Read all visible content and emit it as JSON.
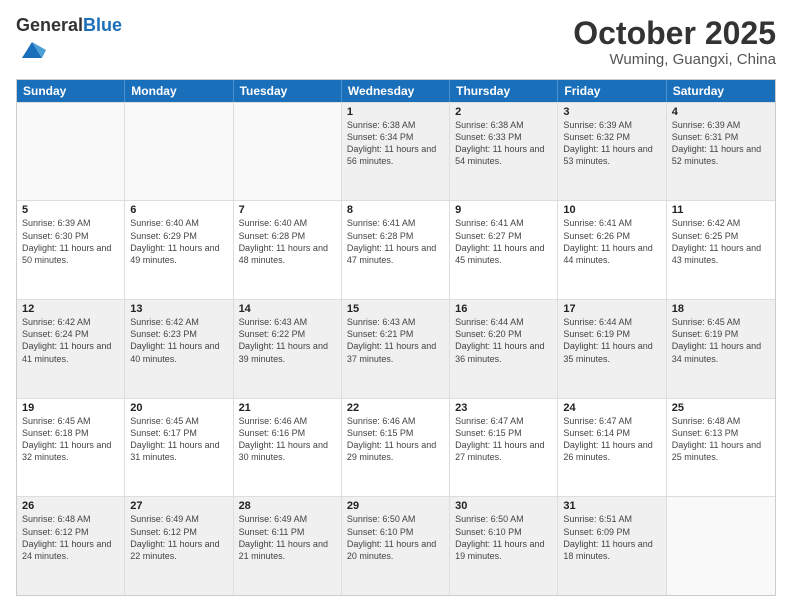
{
  "header": {
    "logo_general": "General",
    "logo_blue": "Blue",
    "month_title": "October 2025",
    "location": "Wuming, Guangxi, China"
  },
  "weekdays": [
    "Sunday",
    "Monday",
    "Tuesday",
    "Wednesday",
    "Thursday",
    "Friday",
    "Saturday"
  ],
  "weeks": [
    [
      {
        "day": "",
        "sunrise": "",
        "sunset": "",
        "daylight": "",
        "empty": true
      },
      {
        "day": "",
        "sunrise": "",
        "sunset": "",
        "daylight": "",
        "empty": true
      },
      {
        "day": "",
        "sunrise": "",
        "sunset": "",
        "daylight": "",
        "empty": true
      },
      {
        "day": "1",
        "sunrise": "Sunrise: 6:38 AM",
        "sunset": "Sunset: 6:34 PM",
        "daylight": "Daylight: 11 hours and 56 minutes.",
        "empty": false
      },
      {
        "day": "2",
        "sunrise": "Sunrise: 6:38 AM",
        "sunset": "Sunset: 6:33 PM",
        "daylight": "Daylight: 11 hours and 54 minutes.",
        "empty": false
      },
      {
        "day": "3",
        "sunrise": "Sunrise: 6:39 AM",
        "sunset": "Sunset: 6:32 PM",
        "daylight": "Daylight: 11 hours and 53 minutes.",
        "empty": false
      },
      {
        "day": "4",
        "sunrise": "Sunrise: 6:39 AM",
        "sunset": "Sunset: 6:31 PM",
        "daylight": "Daylight: 11 hours and 52 minutes.",
        "empty": false
      }
    ],
    [
      {
        "day": "5",
        "sunrise": "Sunrise: 6:39 AM",
        "sunset": "Sunset: 6:30 PM",
        "daylight": "Daylight: 11 hours and 50 minutes.",
        "empty": false
      },
      {
        "day": "6",
        "sunrise": "Sunrise: 6:40 AM",
        "sunset": "Sunset: 6:29 PM",
        "daylight": "Daylight: 11 hours and 49 minutes.",
        "empty": false
      },
      {
        "day": "7",
        "sunrise": "Sunrise: 6:40 AM",
        "sunset": "Sunset: 6:28 PM",
        "daylight": "Daylight: 11 hours and 48 minutes.",
        "empty": false
      },
      {
        "day": "8",
        "sunrise": "Sunrise: 6:41 AM",
        "sunset": "Sunset: 6:28 PM",
        "daylight": "Daylight: 11 hours and 47 minutes.",
        "empty": false
      },
      {
        "day": "9",
        "sunrise": "Sunrise: 6:41 AM",
        "sunset": "Sunset: 6:27 PM",
        "daylight": "Daylight: 11 hours and 45 minutes.",
        "empty": false
      },
      {
        "day": "10",
        "sunrise": "Sunrise: 6:41 AM",
        "sunset": "Sunset: 6:26 PM",
        "daylight": "Daylight: 11 hours and 44 minutes.",
        "empty": false
      },
      {
        "day": "11",
        "sunrise": "Sunrise: 6:42 AM",
        "sunset": "Sunset: 6:25 PM",
        "daylight": "Daylight: 11 hours and 43 minutes.",
        "empty": false
      }
    ],
    [
      {
        "day": "12",
        "sunrise": "Sunrise: 6:42 AM",
        "sunset": "Sunset: 6:24 PM",
        "daylight": "Daylight: 11 hours and 41 minutes.",
        "empty": false
      },
      {
        "day": "13",
        "sunrise": "Sunrise: 6:42 AM",
        "sunset": "Sunset: 6:23 PM",
        "daylight": "Daylight: 11 hours and 40 minutes.",
        "empty": false
      },
      {
        "day": "14",
        "sunrise": "Sunrise: 6:43 AM",
        "sunset": "Sunset: 6:22 PM",
        "daylight": "Daylight: 11 hours and 39 minutes.",
        "empty": false
      },
      {
        "day": "15",
        "sunrise": "Sunrise: 6:43 AM",
        "sunset": "Sunset: 6:21 PM",
        "daylight": "Daylight: 11 hours and 37 minutes.",
        "empty": false
      },
      {
        "day": "16",
        "sunrise": "Sunrise: 6:44 AM",
        "sunset": "Sunset: 6:20 PM",
        "daylight": "Daylight: 11 hours and 36 minutes.",
        "empty": false
      },
      {
        "day": "17",
        "sunrise": "Sunrise: 6:44 AM",
        "sunset": "Sunset: 6:19 PM",
        "daylight": "Daylight: 11 hours and 35 minutes.",
        "empty": false
      },
      {
        "day": "18",
        "sunrise": "Sunrise: 6:45 AM",
        "sunset": "Sunset: 6:19 PM",
        "daylight": "Daylight: 11 hours and 34 minutes.",
        "empty": false
      }
    ],
    [
      {
        "day": "19",
        "sunrise": "Sunrise: 6:45 AM",
        "sunset": "Sunset: 6:18 PM",
        "daylight": "Daylight: 11 hours and 32 minutes.",
        "empty": false
      },
      {
        "day": "20",
        "sunrise": "Sunrise: 6:45 AM",
        "sunset": "Sunset: 6:17 PM",
        "daylight": "Daylight: 11 hours and 31 minutes.",
        "empty": false
      },
      {
        "day": "21",
        "sunrise": "Sunrise: 6:46 AM",
        "sunset": "Sunset: 6:16 PM",
        "daylight": "Daylight: 11 hours and 30 minutes.",
        "empty": false
      },
      {
        "day": "22",
        "sunrise": "Sunrise: 6:46 AM",
        "sunset": "Sunset: 6:15 PM",
        "daylight": "Daylight: 11 hours and 29 minutes.",
        "empty": false
      },
      {
        "day": "23",
        "sunrise": "Sunrise: 6:47 AM",
        "sunset": "Sunset: 6:15 PM",
        "daylight": "Daylight: 11 hours and 27 minutes.",
        "empty": false
      },
      {
        "day": "24",
        "sunrise": "Sunrise: 6:47 AM",
        "sunset": "Sunset: 6:14 PM",
        "daylight": "Daylight: 11 hours and 26 minutes.",
        "empty": false
      },
      {
        "day": "25",
        "sunrise": "Sunrise: 6:48 AM",
        "sunset": "Sunset: 6:13 PM",
        "daylight": "Daylight: 11 hours and 25 minutes.",
        "empty": false
      }
    ],
    [
      {
        "day": "26",
        "sunrise": "Sunrise: 6:48 AM",
        "sunset": "Sunset: 6:12 PM",
        "daylight": "Daylight: 11 hours and 24 minutes.",
        "empty": false
      },
      {
        "day": "27",
        "sunrise": "Sunrise: 6:49 AM",
        "sunset": "Sunset: 6:12 PM",
        "daylight": "Daylight: 11 hours and 22 minutes.",
        "empty": false
      },
      {
        "day": "28",
        "sunrise": "Sunrise: 6:49 AM",
        "sunset": "Sunset: 6:11 PM",
        "daylight": "Daylight: 11 hours and 21 minutes.",
        "empty": false
      },
      {
        "day": "29",
        "sunrise": "Sunrise: 6:50 AM",
        "sunset": "Sunset: 6:10 PM",
        "daylight": "Daylight: 11 hours and 20 minutes.",
        "empty": false
      },
      {
        "day": "30",
        "sunrise": "Sunrise: 6:50 AM",
        "sunset": "Sunset: 6:10 PM",
        "daylight": "Daylight: 11 hours and 19 minutes.",
        "empty": false
      },
      {
        "day": "31",
        "sunrise": "Sunrise: 6:51 AM",
        "sunset": "Sunset: 6:09 PM",
        "daylight": "Daylight: 11 hours and 18 minutes.",
        "empty": false
      },
      {
        "day": "",
        "sunrise": "",
        "sunset": "",
        "daylight": "",
        "empty": true
      }
    ]
  ]
}
